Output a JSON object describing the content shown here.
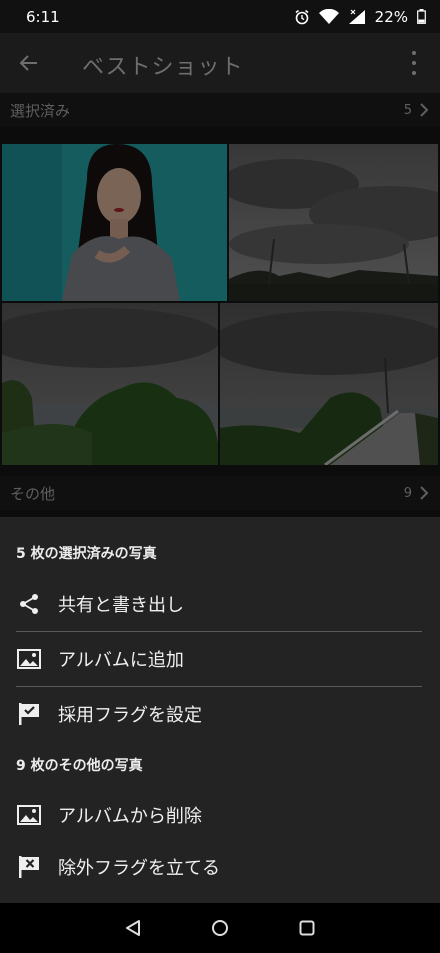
{
  "status_bar": {
    "time": "6:11",
    "battery": "22%"
  },
  "app_bar": {
    "title": "ベストショット"
  },
  "selected_section": {
    "label": "選択済み",
    "count": "5"
  },
  "other_section": {
    "label": "その他",
    "count": "9"
  },
  "sheet": {
    "selected_heading": "5 枚の選択済みの写真",
    "share_label": "共有と書き出し",
    "add_album_label": "アルバムに追加",
    "set_pick_label": "採用フラグを設定",
    "other_heading": "9 枚のその他の写真",
    "remove_album_label": "アルバムから削除",
    "set_reject_label": "除外フラグを立てる"
  },
  "icons": [
    "back-arrow-icon",
    "more-vert-icon",
    "chevron-right-icon",
    "share-icon",
    "image-album-icon",
    "flag-check-icon",
    "flag-x-icon"
  ]
}
